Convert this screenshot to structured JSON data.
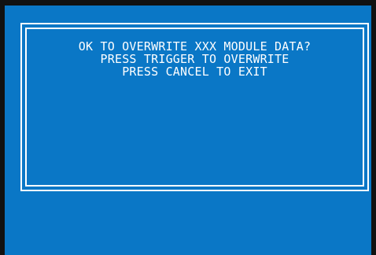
{
  "dialog": {
    "lines": [
      "OK TO OVERWRITE XXX MODULE DATA?",
      "PRESS TRIGGER TO OVERWRITE",
      "PRESS CANCEL TO EXIT"
    ]
  },
  "colors": {
    "screen_background": "#0a77c6",
    "text": "#ffffff",
    "bezel": "#111111",
    "frame": "#ffffff"
  }
}
